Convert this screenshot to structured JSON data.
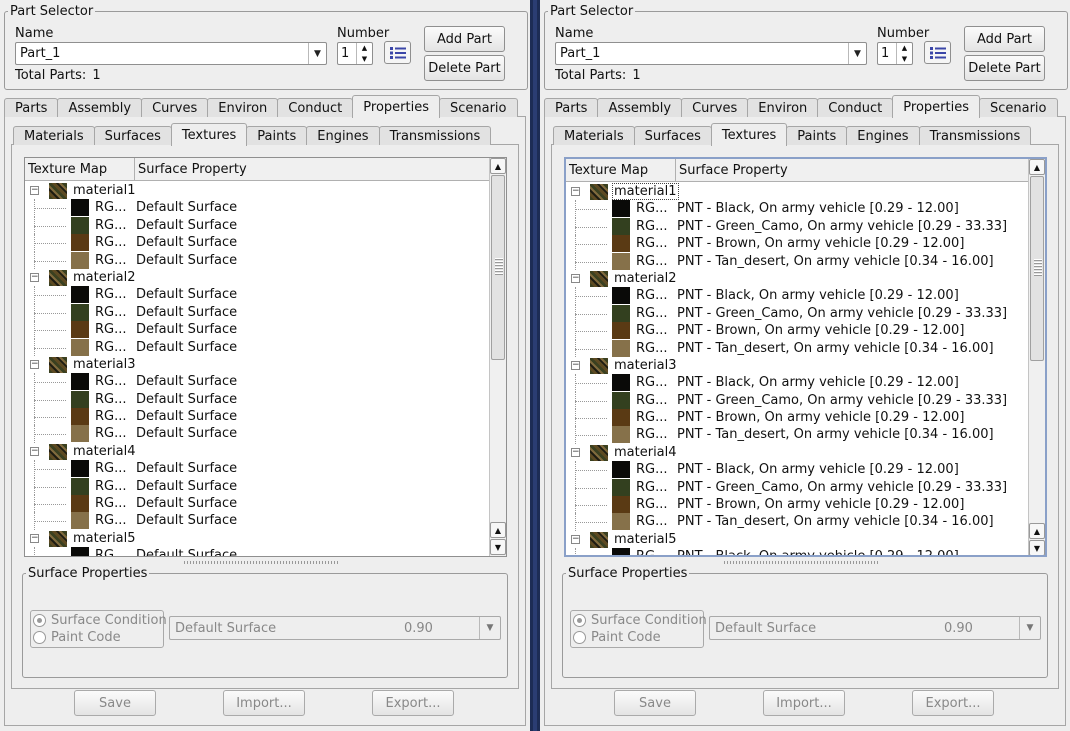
{
  "part_selector": {
    "title": "Part Selector",
    "name_label": "Name",
    "name_value": "Part_1",
    "number_label": "Number",
    "number_value": "1",
    "total_label": "Total Parts:",
    "total_value": "1",
    "add_button": "Add Part",
    "delete_button": "Delete Part"
  },
  "main_tabs": [
    "Parts",
    "Assembly",
    "Curves",
    "Environ",
    "Conduct",
    "Properties",
    "Scenario"
  ],
  "main_tab_active": "Properties",
  "sub_tabs": [
    "Materials",
    "Surfaces",
    "Textures",
    "Paints",
    "Engines",
    "Transmissions"
  ],
  "sub_tab_active": "Textures",
  "tree_headers": {
    "col1": "Texture Map",
    "col2": "Surface Property"
  },
  "texture_code": "RG...",
  "swatch_colors": [
    "#0a0a08",
    "#33401f",
    "#5a3a14",
    "#86714a"
  ],
  "materials": [
    "material1",
    "material2",
    "material3",
    "material4",
    "material5"
  ],
  "left_props": [
    "Default Surface",
    "Default Surface",
    "Default Surface",
    "Default Surface"
  ],
  "right_props": [
    "PNT - Black, On army vehicle  [0.29 - 12.00]",
    "PNT - Green_Camo, On army vehicle  [0.29 - 33.33]",
    "PNT - Brown, On army vehicle  [0.29 - 12.00]",
    "PNT - Tan_desert, On army vehicle  [0.34 - 16.00]"
  ],
  "surface_properties": {
    "title": "Surface Properties",
    "radio_condition": "Surface Condition",
    "radio_paint": "Paint Code",
    "combo_value": "Default Surface",
    "combo_number": "0.90"
  },
  "bottom_buttons": {
    "save": "Save",
    "import": "Import...",
    "export": "Export..."
  }
}
